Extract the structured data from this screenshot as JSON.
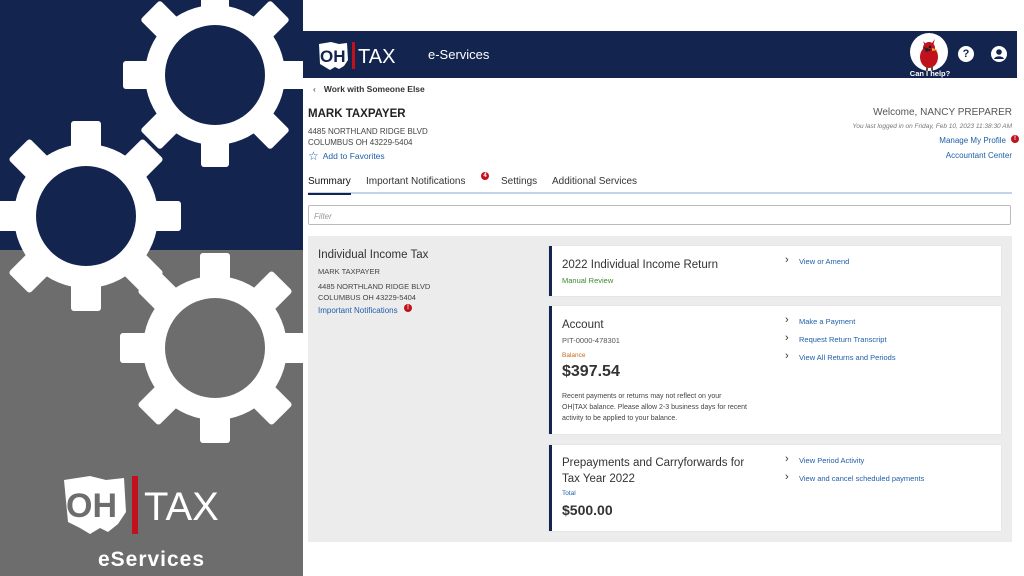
{
  "brand": {
    "logo_left": "OH",
    "logo_right": "TAX",
    "caption": "eServices"
  },
  "topbar": {
    "logo_left": "OH",
    "logo_right": "TAX",
    "app_name": "e-Services",
    "help_caption": "Can I help?",
    "help_icon": "question-icon",
    "user_icon": "user-icon"
  },
  "back_link": "Work with Someone Else",
  "taxpayer": {
    "name": "MARK TAXPAYER",
    "address1": "4485 NORTHLAND RIDGE BLVD",
    "address2": "COLUMBUS OH 43229-5404",
    "favorites": "Add to Favorites"
  },
  "user": {
    "welcome": "Welcome, NANCY PREPARER",
    "last_login": "You last logged in on Friday, Feb 10, 2023 11:38:30 AM",
    "manage_profile": "Manage My Profile",
    "profile_badge": "!",
    "accountant_center": "Accountant Center"
  },
  "tabs": [
    {
      "label": "Summary"
    },
    {
      "label": "Important Notifications"
    },
    {
      "label": "Settings"
    },
    {
      "label": "Additional Services"
    }
  ],
  "tab_notification_count": "4",
  "filter_placeholder": "Filter",
  "tax_account": {
    "title": "Individual Income Tax",
    "name": "MARK TAXPAYER",
    "address1": "4485 NORTHLAND RIDGE BLVD",
    "address2": "COLUMBUS OH 43229-5404",
    "notifications_link": "Important Notifications",
    "notifications_badge": "!"
  },
  "cards": {
    "return": {
      "title": "2022 Individual Income Return",
      "status": "Manual Review",
      "links": [
        "View or Amend"
      ]
    },
    "account": {
      "title": "Account",
      "number": "PIT-0000-478301",
      "balance_label": "Balance",
      "balance": "$397.54",
      "note_line1": "Recent payments or returns may not reflect on your",
      "note_line2": "OH|TAX balance. Please allow 2-3 business days for recent",
      "note_line3": "activity to be applied to your balance.",
      "links": [
        "Make a Payment",
        "Request Return Transcript",
        "View All Returns and Periods"
      ]
    },
    "prepayments": {
      "title_line1": "Prepayments and Carryforwards for",
      "title_line2": "Tax Year 2022",
      "total_label": "Total",
      "total": "$500.00",
      "links": [
        "View Period Activity",
        "View and cancel scheduled payments"
      ]
    }
  },
  "colors": {
    "navy": "#13254f",
    "link_blue": "#1f5fa8",
    "alert_red": "#c0111d",
    "balance_orange": "#c66a1c",
    "status_green": "#3d8a2c"
  }
}
